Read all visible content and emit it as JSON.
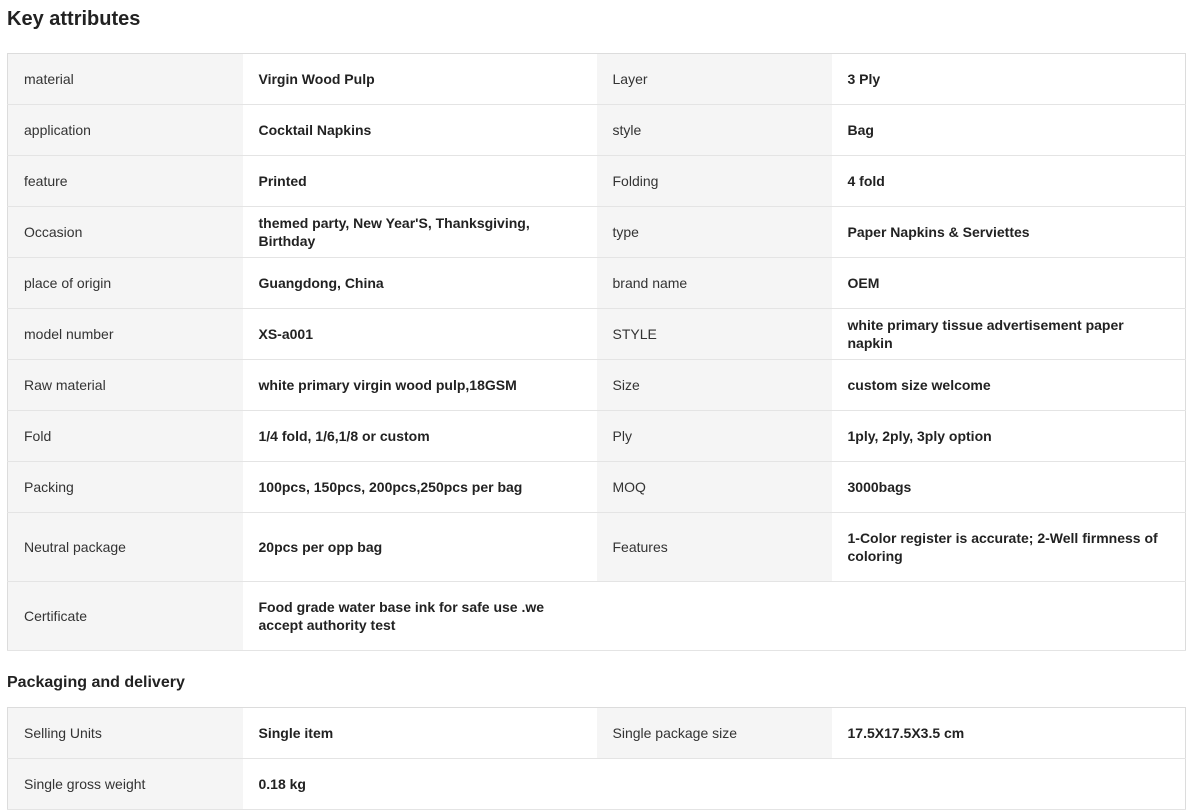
{
  "key_attributes": {
    "title": "Key attributes",
    "rows": [
      {
        "k1": "material",
        "v1": "Virgin Wood Pulp",
        "k2": "Layer",
        "v2": "3 Ply"
      },
      {
        "k1": "application",
        "v1": "Cocktail Napkins",
        "k2": "style",
        "v2": "Bag"
      },
      {
        "k1": "feature",
        "v1": "Printed",
        "k2": "Folding",
        "v2": "4 fold"
      },
      {
        "k1": "Occasion",
        "v1": "themed party, New Year'S, Thanksgiving, Birthday",
        "k2": "type",
        "v2": "Paper Napkins & Serviettes"
      },
      {
        "k1": "place of origin",
        "v1": "Guangdong, China",
        "k2": "brand name",
        "v2": "OEM"
      },
      {
        "k1": "model number",
        "v1": "XS-a001",
        "k2": "STYLE",
        "v2": "white primary tissue advertisement paper napkin"
      },
      {
        "k1": "Raw material",
        "v1": "white primary virgin wood pulp,18GSM",
        "k2": "Size",
        "v2": "custom size welcome"
      },
      {
        "k1": "Fold",
        "v1": "1/4 fold, 1/6,1/8 or custom",
        "k2": "Ply",
        "v2": "1ply, 2ply, 3ply option"
      },
      {
        "k1": "Packing",
        "v1": "100pcs, 150pcs, 200pcs,250pcs per bag",
        "k2": "MOQ",
        "v2": "3000bags"
      },
      {
        "k1": "Neutral package",
        "v1": "20pcs per opp bag",
        "k2": "Features",
        "v2": "1-Color register is accurate; 2-Well firmness of coloring"
      },
      {
        "k1": "Certificate",
        "v1": "Food grade water base ink for safe use .we accept authority test",
        "k2": "",
        "v2": ""
      }
    ]
  },
  "packaging_delivery": {
    "title": "Packaging and delivery",
    "rows": [
      {
        "k1": "Selling Units",
        "v1": "Single item",
        "k2": "Single package size",
        "v2": "17.5X17.5X3.5 cm"
      },
      {
        "k1": "Single gross weight",
        "v1": "0.18 kg",
        "k2": "",
        "v2": ""
      }
    ]
  }
}
